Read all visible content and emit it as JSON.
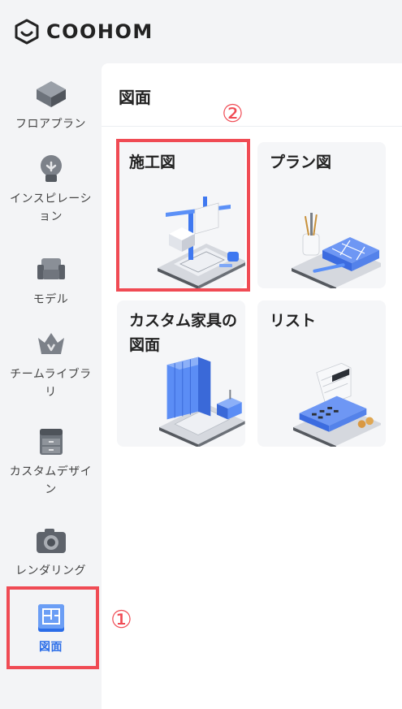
{
  "logo": {
    "name": "COOHOM"
  },
  "sidebar": {
    "items": [
      {
        "label": "フロアプラン",
        "icon": "floorplan-icon"
      },
      {
        "label": "インスピレーション",
        "icon": "lightbulb-icon"
      },
      {
        "label": "モデル",
        "icon": "sofa-icon"
      },
      {
        "label": "チームライブラリ",
        "icon": "crown-icon"
      },
      {
        "label": "カスタムデザイン",
        "icon": "cabinet-icon"
      },
      {
        "label": "レンダリング",
        "icon": "camera-icon"
      },
      {
        "label": "図面",
        "icon": "drawing-icon",
        "active": true
      }
    ]
  },
  "panel": {
    "title": "図面",
    "cards": [
      {
        "title": "施工図",
        "illustration": "construction-crane-illustration"
      },
      {
        "title": "プラン図",
        "illustration": "floor-plan-pencil-illustration"
      },
      {
        "title": "カスタム家具の図面",
        "illustration": "cabinets-illustration"
      },
      {
        "title": "リスト",
        "illustration": "calculator-illustration"
      }
    ]
  },
  "annotations": {
    "marker_1": "①",
    "marker_2": "②"
  },
  "colors": {
    "accent": "#2b6de8",
    "highlight": "#f04b54",
    "sidebar_bg": "#f3f4f6",
    "card_bg": "#f5f6f8"
  }
}
